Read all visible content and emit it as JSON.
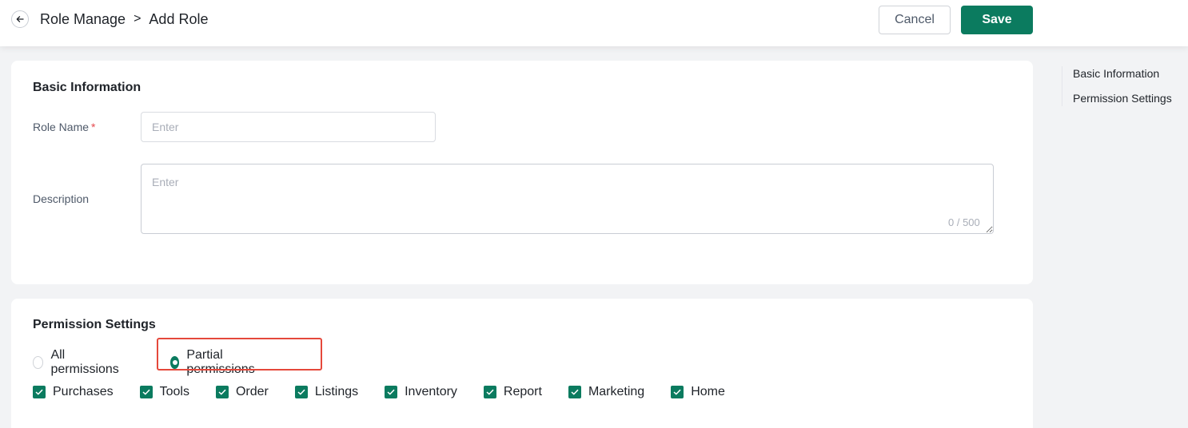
{
  "header": {
    "breadcrumb_parent": "Role Manage",
    "breadcrumb_separator": ">",
    "breadcrumb_current": "Add Role",
    "cancel_label": "Cancel",
    "save_label": "Save",
    "back_icon": "arrow-left-icon"
  },
  "basic_info": {
    "title": "Basic Information",
    "role_name_label": "Role Name",
    "required_mark": "*",
    "role_name_placeholder": "Enter",
    "role_name_value": "",
    "description_label": "Description",
    "description_placeholder": "Enter",
    "description_value": "",
    "description_counter": "0 / 500"
  },
  "permission_settings": {
    "title": "Permission Settings",
    "radio_options": [
      {
        "label": "All permissions",
        "selected": false
      },
      {
        "label": "Partial permissions",
        "selected": true
      }
    ],
    "modules": [
      {
        "label": "Purchases",
        "checked": true
      },
      {
        "label": "Tools",
        "checked": true
      },
      {
        "label": "Order",
        "checked": true
      },
      {
        "label": "Listings",
        "checked": true
      },
      {
        "label": "Inventory",
        "checked": true
      },
      {
        "label": "Report",
        "checked": true
      },
      {
        "label": "Marketing",
        "checked": true
      },
      {
        "label": "Home",
        "checked": true
      }
    ]
  },
  "side_nav": {
    "items": [
      "Basic Information",
      "Permission Settings"
    ]
  },
  "colors": {
    "primary": "#0b7b5f",
    "highlight_border": "#e5483b",
    "required": "#e5484d",
    "background": "#f2f3f5"
  }
}
